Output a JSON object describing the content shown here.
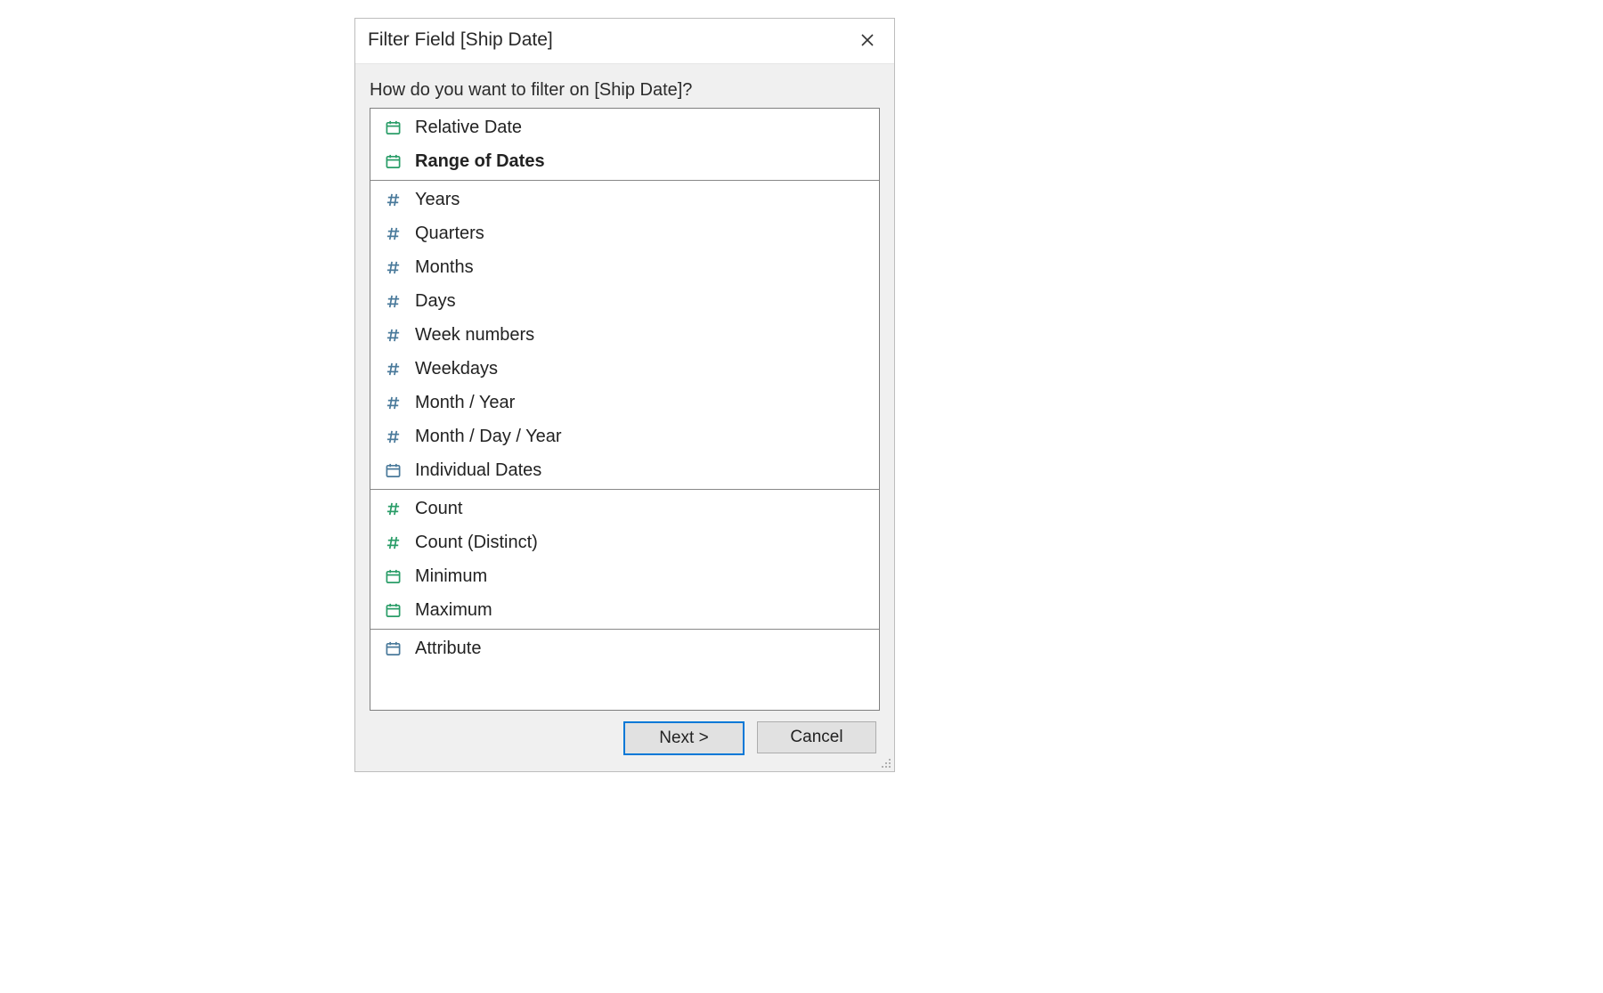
{
  "dialog": {
    "title": "Filter Field [Ship Date]",
    "prompt": "How do you want to filter on [Ship Date]?"
  },
  "icons": {
    "calendar_green": "calendar-green-icon",
    "calendar_blue": "calendar-blue-icon",
    "hash_green": "hash-green-icon",
    "hash_blue": "hash-blue-icon"
  },
  "groups": [
    {
      "options": [
        {
          "icon": "calendar_green",
          "label": "Relative Date",
          "selected": false
        },
        {
          "icon": "calendar_green",
          "label": "Range of Dates",
          "selected": true
        }
      ]
    },
    {
      "options": [
        {
          "icon": "hash_blue",
          "label": "Years",
          "selected": false
        },
        {
          "icon": "hash_blue",
          "label": "Quarters",
          "selected": false
        },
        {
          "icon": "hash_blue",
          "label": "Months",
          "selected": false
        },
        {
          "icon": "hash_blue",
          "label": "Days",
          "selected": false
        },
        {
          "icon": "hash_blue",
          "label": "Week numbers",
          "selected": false
        },
        {
          "icon": "hash_blue",
          "label": "Weekdays",
          "selected": false
        },
        {
          "icon": "hash_blue",
          "label": "Month / Year",
          "selected": false
        },
        {
          "icon": "hash_blue",
          "label": "Month / Day / Year",
          "selected": false
        },
        {
          "icon": "calendar_blue",
          "label": "Individual Dates",
          "selected": false
        }
      ]
    },
    {
      "options": [
        {
          "icon": "hash_green",
          "label": "Count",
          "selected": false
        },
        {
          "icon": "hash_green",
          "label": "Count (Distinct)",
          "selected": false
        },
        {
          "icon": "calendar_green",
          "label": "Minimum",
          "selected": false
        },
        {
          "icon": "calendar_green",
          "label": "Maximum",
          "selected": false
        }
      ]
    },
    {
      "options": [
        {
          "icon": "calendar_blue",
          "label": "Attribute",
          "selected": false
        }
      ]
    }
  ],
  "buttons": {
    "next": "Next >",
    "cancel": "Cancel"
  },
  "colors": {
    "green": "#2a9d68",
    "blue": "#4a7a9b"
  }
}
